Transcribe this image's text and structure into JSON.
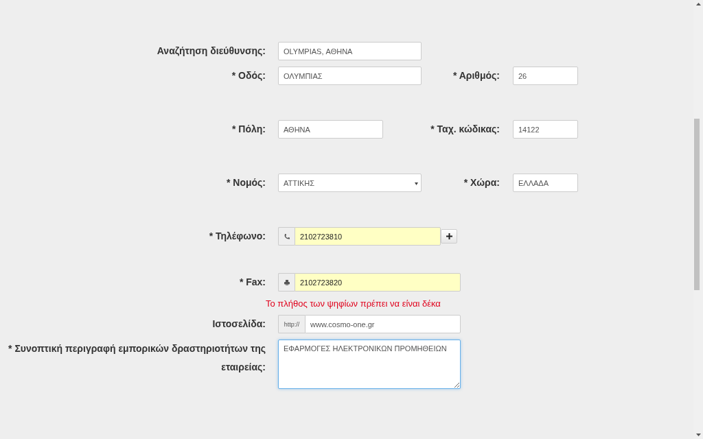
{
  "rows": [
    {
      "kind": "fields",
      "fields": [
        {
          "label": "Αναζήτηση διεύθυνσης:",
          "kind": "text",
          "value": "OLYMPIAS, ΑΘΗΝΑ",
          "autofilled": false,
          "focused": false
        }
      ]
    },
    {
      "kind": "fields",
      "fields": [
        {
          "label": "* Οδός:",
          "kind": "text",
          "value": "ΟΛΥΜΠΙΑΣ",
          "autofilled": false,
          "focused": false
        },
        {
          "label": "* Αριθμός:",
          "kind": "text",
          "value": "26",
          "autofilled": false,
          "focused": false
        }
      ]
    },
    {
      "kind": "fields",
      "fields": [
        {
          "label": "* Πόλη:",
          "kind": "text",
          "value": "ΑΘΗΝΑ",
          "autofilled": false,
          "focused": false
        },
        {
          "label": "* Ταχ. κώδικας:",
          "kind": "text",
          "value": "14122",
          "autofilled": false,
          "focused": false
        }
      ]
    },
    {
      "kind": "fields",
      "fields": [
        {
          "label": "* Νομός:",
          "kind": "select",
          "value": "ΑΤΤΙΚΗΣ",
          "autofilled": false,
          "focused": false
        },
        {
          "label": "* Χώρα:",
          "kind": "text",
          "value": "ΕΛΛΑΔΑ",
          "autofilled": false,
          "focused": false
        }
      ]
    },
    {
      "kind": "fields",
      "fields": [
        {
          "label": "* Τηλέφωνο:",
          "kind": "phone",
          "value": "2102723810",
          "autofilled": true,
          "focused": false
        }
      ]
    },
    {
      "kind": "fields",
      "fields": [
        {
          "label": "* Fax:",
          "kind": "fax",
          "value": "2102723820",
          "autofilled": true,
          "focused": false
        }
      ]
    },
    {
      "kind": "message",
      "text": "Το πλήθος των ψηφίων πρέπει να είναι δέκα"
    },
    {
      "kind": "fields",
      "fields": [
        {
          "label": "Ιστοσελίδα:",
          "kind": "url",
          "prefix": "http://",
          "value": "www.cosmo-one.gr",
          "autofilled": false,
          "focused": false
        }
      ]
    },
    {
      "kind": "fields",
      "fields": [
        {
          "label": "* Συνοπτική περιγραφή εμπορικών δραστηριοτήτων της εταιρείας:",
          "kind": "textarea",
          "value": "ΕΦΑΡΜΟΓΕΣ ΗΛΕΚΤΡΟΝΙΚΩΝ ΠΡΟΜΗΘΕΙΩΝ",
          "autofilled": false,
          "focused": true
        }
      ]
    }
  ]
}
